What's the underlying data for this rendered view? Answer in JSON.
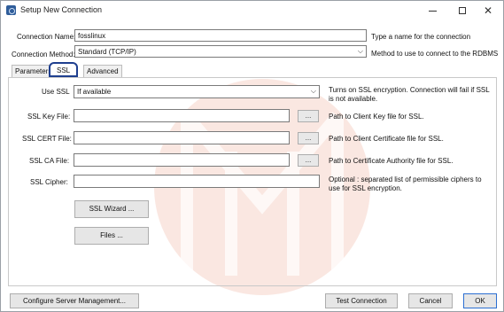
{
  "window": {
    "title": "Setup New Connection"
  },
  "form": {
    "connection_name_label": "Connection Name:",
    "connection_name_value": "fosslinux",
    "connection_name_hint": "Type a name for the connection",
    "method_label": "Connection Method:",
    "method_value": "Standard (TCP/IP)",
    "method_hint": "Method to use to connect to the RDBMS"
  },
  "tabs": [
    {
      "label": "Parameters"
    },
    {
      "label": "SSL"
    },
    {
      "label": "Advanced"
    }
  ],
  "ssl": {
    "use_ssl_label": "Use SSL",
    "use_ssl_value": "If available",
    "use_ssl_hint_1": "Turns on SSL encryption. Connection will fail if SSL",
    "use_ssl_hint_2": "is not available.",
    "key_file_label": "SSL Key File:",
    "key_file_hint": "Path to Client Key file for SSL.",
    "cert_file_label": "SSL CERT File:",
    "cert_file_hint": "Path to Client Certificate file for SSL.",
    "ca_file_label": "SSL CA File:",
    "ca_file_hint": "Path to Certificate Authority file for SSL.",
    "cipher_label": "SSL Cipher:",
    "cipher_hint_1": "Optional : separated list of permissible ciphers to",
    "cipher_hint_2": "use for SSL encryption.",
    "browse_label": "...",
    "wizard_button": "SSL Wizard ...",
    "files_button": "Files ..."
  },
  "footer": {
    "configure_button": "Configure Server Management...",
    "test_button": "Test Connection",
    "cancel_button": "Cancel",
    "ok_button": "OK"
  },
  "colors": {
    "accent": "#1f3f8f",
    "watermark": "#f3c9bd"
  }
}
